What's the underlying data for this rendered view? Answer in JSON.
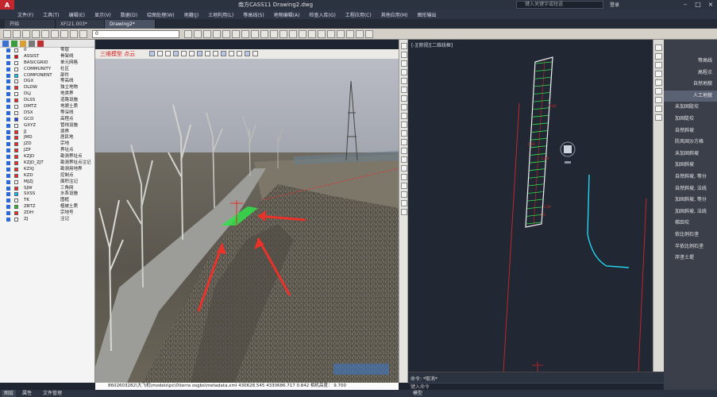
{
  "app": {
    "title": "南方CASS11    Drawing2.dwg",
    "search_placeholder": "键入关键字或短语",
    "login": "登录"
  },
  "menus": [
    "文件(F)",
    "工具(T)",
    "编辑(E)",
    "显示(V)",
    "数据(D)",
    "绘图处理(W)",
    "地籍(J)",
    "土地利用(L)",
    "等高线(S)",
    "地物编辑(A)",
    "检查入库(G)",
    "工程应用(C)",
    "其他应用(M)",
    "图形输出"
  ],
  "doc_tabs": [
    {
      "label": "开始",
      "active": false
    },
    {
      "label": "XF(21.003*",
      "active": false
    },
    {
      "label": "Drawing2*",
      "active": true
    }
  ],
  "toolbar": {
    "layer_combo": "0"
  },
  "layers": [
    {
      "name": "0",
      "desc": "零层",
      "color": "#ffffff"
    },
    {
      "name": "ASSIST",
      "desc": "骨架线",
      "color": "#ff0000"
    },
    {
      "name": "BASICGRID",
      "desc": "单元网格",
      "color": "#ffffff"
    },
    {
      "name": "COMMUNITY",
      "desc": "社区",
      "color": "#ffffff"
    },
    {
      "name": "COMPONENT",
      "desc": "部件",
      "color": "#00c8ff"
    },
    {
      "name": "DGX",
      "desc": "等高线",
      "color": "#ffffff"
    },
    {
      "name": "DLDW",
      "desc": "独立地物",
      "color": "#ff2020"
    },
    {
      "name": "DLJ",
      "desc": "地类界",
      "color": "#ffffff"
    },
    {
      "name": "DLSS",
      "desc": "道路设施",
      "color": "#ff2020"
    },
    {
      "name": "DMTZ",
      "desc": "地貌土质",
      "color": "#ffffff"
    },
    {
      "name": "DSX",
      "desc": "等深线",
      "color": "#ffffff"
    },
    {
      "name": "GCD",
      "desc": "高程点",
      "color": "#2040ff"
    },
    {
      "name": "GXYZ",
      "desc": "管线设施",
      "color": "#ffffff"
    },
    {
      "name": "JJ",
      "desc": "境界",
      "color": "#ff2020"
    },
    {
      "name": "JMD",
      "desc": "居民地",
      "color": "#ff2020"
    },
    {
      "name": "JZD",
      "desc": "宗地",
      "color": "#ff2020"
    },
    {
      "name": "JZP",
      "desc": "界址点",
      "color": "#ff2020"
    },
    {
      "name": "KZJD",
      "desc": "勘测界址点",
      "color": "#ff2020"
    },
    {
      "name": "KZJD_ZJT",
      "desc": "勘测界址点注记",
      "color": "#ff2020"
    },
    {
      "name": "KZXJ",
      "desc": "勘测用地界",
      "color": "#ff2020"
    },
    {
      "name": "KZD",
      "desc": "控制点",
      "color": "#ff2020"
    },
    {
      "name": "MJZJ",
      "desc": "面积注记",
      "color": "#ffffff"
    },
    {
      "name": "SJW",
      "desc": "三角网",
      "color": "#ff2020"
    },
    {
      "name": "SXSS",
      "desc": "水系设施",
      "color": "#00c0ff"
    },
    {
      "name": "TK",
      "desc": "图框",
      "color": "#ffffff"
    },
    {
      "name": "ZBTZ",
      "desc": "植被土质",
      "color": "#20c020"
    },
    {
      "name": "ZDH",
      "desc": "宗地号",
      "color": "#ff2020"
    },
    {
      "name": "ZJ",
      "desc": "注记",
      "color": "#ffffff"
    }
  ],
  "viewport3d": {
    "toolbar_label": "三维模型 点云",
    "status": "8602603282\\大飞机\\models\\pc\\0\\terra osgbs\\metadata.xml   430628.545   4330686.717        0.842  相机高度：         9.700"
  },
  "viewport2d": {
    "label": "[-][俯视][二维线框]",
    "dim_labels": [
      "5.82",
      "1.30",
      "1.00",
      "1.00",
      "1.0"
    ]
  },
  "command": {
    "history": "命令: *取消*",
    "prompt": "键入命令"
  },
  "palette": {
    "items": [
      {
        "label": "等高线",
        "align": "right",
        "selected": false
      },
      {
        "label": "高程点",
        "align": "right",
        "selected": false
      },
      {
        "label": "自然地貌",
        "align": "right",
        "selected": false
      },
      {
        "label": "人工地貌",
        "align": "right",
        "selected": true
      },
      {
        "label": "未加固陡坎",
        "align": "left",
        "selected": false
      },
      {
        "label": "加固陡坎",
        "align": "left",
        "selected": false
      },
      {
        "label": "自然斜坡",
        "align": "left",
        "selected": false
      },
      {
        "label": "防风固沙方格",
        "align": "left",
        "selected": false
      },
      {
        "label": "未加固斜坡",
        "align": "left",
        "selected": false
      },
      {
        "label": "加固斜坡",
        "align": "left",
        "selected": false
      },
      {
        "label": "自然斜坡, 等分",
        "align": "left",
        "selected": false
      },
      {
        "label": "自然斜坡, 法线",
        "align": "left",
        "selected": false
      },
      {
        "label": "加固斜坡, 等分",
        "align": "left",
        "selected": false
      },
      {
        "label": "加固斜坡, 法线",
        "align": "left",
        "selected": false
      },
      {
        "label": "梯田坎",
        "align": "left",
        "selected": false
      },
      {
        "label": "依比例石垄",
        "align": "left",
        "selected": false
      },
      {
        "label": "半依比例石垄",
        "align": "left",
        "selected": false
      },
      {
        "label": "岸垄土堤",
        "align": "left",
        "selected": false
      }
    ]
  },
  "bottom": {
    "tabs": [
      "图层",
      "属性",
      "文件管理"
    ],
    "readout": "模型"
  },
  "colors": {
    "annotation_arrow": "#e8322a",
    "slope_green": "#33e04a",
    "contour_cyan": "#22d6f0"
  }
}
